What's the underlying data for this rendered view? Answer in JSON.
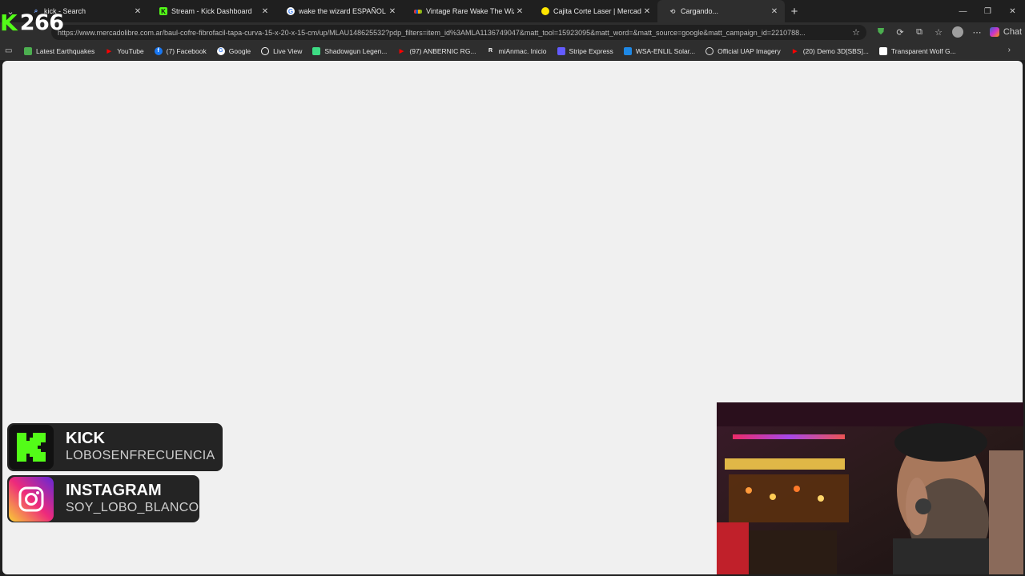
{
  "stream_overlay": {
    "viewer_count": "266",
    "kick_badge": {
      "platform": "KICK",
      "handle": "LOBOSENFRECUENCIA"
    },
    "instagram_badge": {
      "platform": "INSTAGRAM",
      "handle": "SOY_LOBO_BLANCO"
    }
  },
  "browser": {
    "tabs": [
      {
        "title": "kick - Search",
        "favicon": "search-icon",
        "color": "#7aa7ff"
      },
      {
        "title": "Stream - Kick Dashboard",
        "favicon": "kick-icon",
        "color": "#53fc18"
      },
      {
        "title": "wake the wizard ESPAÑOL VIDEO",
        "favicon": "google-icon",
        "color": "#ffffff"
      },
      {
        "title": "Vintage Rare Wake The Wizard Th",
        "favicon": "ebay-icon",
        "color": "#e53238"
      },
      {
        "title": "Cajita Corte Laser | MercadoLibre 📦",
        "favicon": "mercadolibre-icon",
        "color": "#ffe600"
      },
      {
        "title": "Cargando...",
        "favicon": "loading-icon",
        "color": "#bdbdbd",
        "active": true
      }
    ],
    "address_bar": {
      "url": "https://www.mercadolibre.com.ar/baul-cofre-fibrofacil-tapa-curva-15-x-20-x-15-cm/up/MLAU148625532?pdp_filters=item_id%3AMLA1136749047&matt_tool=15923095&matt_word=&matt_source=google&matt_campaign_id=2210788..."
    },
    "chat_label": "Chat",
    "bookmarks": [
      {
        "label": "Latest Earthquakes",
        "icon": "earthquake-icon",
        "color": "#4caf50"
      },
      {
        "label": "YouTube",
        "icon": "youtube-icon",
        "color": "#ff0000"
      },
      {
        "label": "(7) Facebook",
        "icon": "facebook-icon",
        "color": "#1877f2"
      },
      {
        "label": "Google",
        "icon": "google-icon",
        "color": "#ffffff"
      },
      {
        "label": "Live View",
        "icon": "github-icon",
        "color": "#ffffff"
      },
      {
        "label": "Shadowgun Legen...",
        "icon": "android-icon",
        "color": "#3ddc84"
      },
      {
        "label": "(97) ANBERNIC RG...",
        "icon": "youtube-icon",
        "color": "#ff0000"
      },
      {
        "label": "miAnmac. Inicio",
        "icon": "r-icon",
        "color": "#ffffff"
      },
      {
        "label": "Stripe Express",
        "icon": "stripe-icon",
        "color": "#635bff"
      },
      {
        "label": "WSA-ENLIL Solar...",
        "icon": "noaa-icon",
        "color": "#1e88e5"
      },
      {
        "label": "Official UAP Imagery",
        "icon": "globe-icon",
        "color": "#ffffff"
      },
      {
        "label": "(20) Demo 3D[SBS]...",
        "icon": "youtube-icon",
        "color": "#ff0000"
      },
      {
        "label": "Transparent Wolf G...",
        "icon": "document-icon",
        "color": "#ffffff"
      }
    ]
  }
}
